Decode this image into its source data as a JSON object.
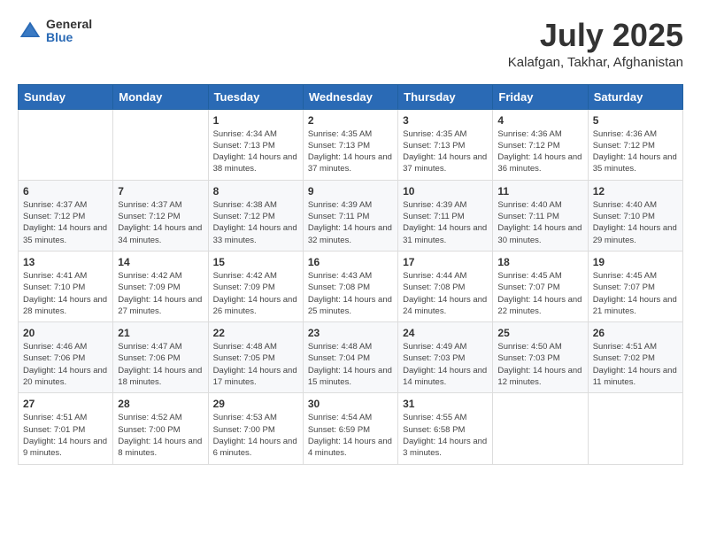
{
  "header": {
    "logo": {
      "general": "General",
      "blue": "Blue"
    },
    "title": "July 2025",
    "location": "Kalafgan, Takhar, Afghanistan"
  },
  "calendar": {
    "days_of_week": [
      "Sunday",
      "Monday",
      "Tuesday",
      "Wednesday",
      "Thursday",
      "Friday",
      "Saturday"
    ],
    "weeks": [
      [
        {
          "day": null
        },
        {
          "day": null
        },
        {
          "day": "1",
          "sunrise": "Sunrise: 4:34 AM",
          "sunset": "Sunset: 7:13 PM",
          "daylight": "Daylight: 14 hours and 38 minutes."
        },
        {
          "day": "2",
          "sunrise": "Sunrise: 4:35 AM",
          "sunset": "Sunset: 7:13 PM",
          "daylight": "Daylight: 14 hours and 37 minutes."
        },
        {
          "day": "3",
          "sunrise": "Sunrise: 4:35 AM",
          "sunset": "Sunset: 7:13 PM",
          "daylight": "Daylight: 14 hours and 37 minutes."
        },
        {
          "day": "4",
          "sunrise": "Sunrise: 4:36 AM",
          "sunset": "Sunset: 7:12 PM",
          "daylight": "Daylight: 14 hours and 36 minutes."
        },
        {
          "day": "5",
          "sunrise": "Sunrise: 4:36 AM",
          "sunset": "Sunset: 7:12 PM",
          "daylight": "Daylight: 14 hours and 35 minutes."
        }
      ],
      [
        {
          "day": "6",
          "sunrise": "Sunrise: 4:37 AM",
          "sunset": "Sunset: 7:12 PM",
          "daylight": "Daylight: 14 hours and 35 minutes."
        },
        {
          "day": "7",
          "sunrise": "Sunrise: 4:37 AM",
          "sunset": "Sunset: 7:12 PM",
          "daylight": "Daylight: 14 hours and 34 minutes."
        },
        {
          "day": "8",
          "sunrise": "Sunrise: 4:38 AM",
          "sunset": "Sunset: 7:12 PM",
          "daylight": "Daylight: 14 hours and 33 minutes."
        },
        {
          "day": "9",
          "sunrise": "Sunrise: 4:39 AM",
          "sunset": "Sunset: 7:11 PM",
          "daylight": "Daylight: 14 hours and 32 minutes."
        },
        {
          "day": "10",
          "sunrise": "Sunrise: 4:39 AM",
          "sunset": "Sunset: 7:11 PM",
          "daylight": "Daylight: 14 hours and 31 minutes."
        },
        {
          "day": "11",
          "sunrise": "Sunrise: 4:40 AM",
          "sunset": "Sunset: 7:11 PM",
          "daylight": "Daylight: 14 hours and 30 minutes."
        },
        {
          "day": "12",
          "sunrise": "Sunrise: 4:40 AM",
          "sunset": "Sunset: 7:10 PM",
          "daylight": "Daylight: 14 hours and 29 minutes."
        }
      ],
      [
        {
          "day": "13",
          "sunrise": "Sunrise: 4:41 AM",
          "sunset": "Sunset: 7:10 PM",
          "daylight": "Daylight: 14 hours and 28 minutes."
        },
        {
          "day": "14",
          "sunrise": "Sunrise: 4:42 AM",
          "sunset": "Sunset: 7:09 PM",
          "daylight": "Daylight: 14 hours and 27 minutes."
        },
        {
          "day": "15",
          "sunrise": "Sunrise: 4:42 AM",
          "sunset": "Sunset: 7:09 PM",
          "daylight": "Daylight: 14 hours and 26 minutes."
        },
        {
          "day": "16",
          "sunrise": "Sunrise: 4:43 AM",
          "sunset": "Sunset: 7:08 PM",
          "daylight": "Daylight: 14 hours and 25 minutes."
        },
        {
          "day": "17",
          "sunrise": "Sunrise: 4:44 AM",
          "sunset": "Sunset: 7:08 PM",
          "daylight": "Daylight: 14 hours and 24 minutes."
        },
        {
          "day": "18",
          "sunrise": "Sunrise: 4:45 AM",
          "sunset": "Sunset: 7:07 PM",
          "daylight": "Daylight: 14 hours and 22 minutes."
        },
        {
          "day": "19",
          "sunrise": "Sunrise: 4:45 AM",
          "sunset": "Sunset: 7:07 PM",
          "daylight": "Daylight: 14 hours and 21 minutes."
        }
      ],
      [
        {
          "day": "20",
          "sunrise": "Sunrise: 4:46 AM",
          "sunset": "Sunset: 7:06 PM",
          "daylight": "Daylight: 14 hours and 20 minutes."
        },
        {
          "day": "21",
          "sunrise": "Sunrise: 4:47 AM",
          "sunset": "Sunset: 7:06 PM",
          "daylight": "Daylight: 14 hours and 18 minutes."
        },
        {
          "day": "22",
          "sunrise": "Sunrise: 4:48 AM",
          "sunset": "Sunset: 7:05 PM",
          "daylight": "Daylight: 14 hours and 17 minutes."
        },
        {
          "day": "23",
          "sunrise": "Sunrise: 4:48 AM",
          "sunset": "Sunset: 7:04 PM",
          "daylight": "Daylight: 14 hours and 15 minutes."
        },
        {
          "day": "24",
          "sunrise": "Sunrise: 4:49 AM",
          "sunset": "Sunset: 7:03 PM",
          "daylight": "Daylight: 14 hours and 14 minutes."
        },
        {
          "day": "25",
          "sunrise": "Sunrise: 4:50 AM",
          "sunset": "Sunset: 7:03 PM",
          "daylight": "Daylight: 14 hours and 12 minutes."
        },
        {
          "day": "26",
          "sunrise": "Sunrise: 4:51 AM",
          "sunset": "Sunset: 7:02 PM",
          "daylight": "Daylight: 14 hours and 11 minutes."
        }
      ],
      [
        {
          "day": "27",
          "sunrise": "Sunrise: 4:51 AM",
          "sunset": "Sunset: 7:01 PM",
          "daylight": "Daylight: 14 hours and 9 minutes."
        },
        {
          "day": "28",
          "sunrise": "Sunrise: 4:52 AM",
          "sunset": "Sunset: 7:00 PM",
          "daylight": "Daylight: 14 hours and 8 minutes."
        },
        {
          "day": "29",
          "sunrise": "Sunrise: 4:53 AM",
          "sunset": "Sunset: 7:00 PM",
          "daylight": "Daylight: 14 hours and 6 minutes."
        },
        {
          "day": "30",
          "sunrise": "Sunrise: 4:54 AM",
          "sunset": "Sunset: 6:59 PM",
          "daylight": "Daylight: 14 hours and 4 minutes."
        },
        {
          "day": "31",
          "sunrise": "Sunrise: 4:55 AM",
          "sunset": "Sunset: 6:58 PM",
          "daylight": "Daylight: 14 hours and 3 minutes."
        },
        {
          "day": null
        },
        {
          "day": null
        }
      ]
    ]
  }
}
